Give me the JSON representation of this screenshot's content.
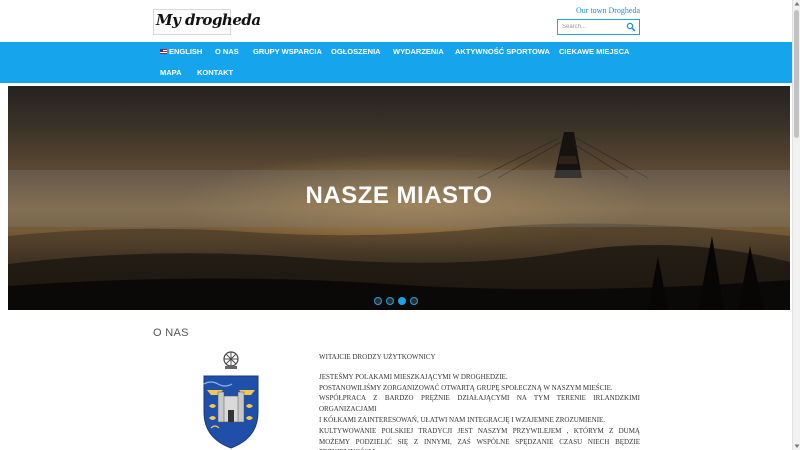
{
  "header": {
    "logo_text": "My drogheda",
    "top_link": "Our town Drogheda",
    "search_placeholder": "Search..."
  },
  "nav": {
    "items": [
      {
        "label": "English",
        "flag": true
      },
      {
        "label": "O nas"
      },
      {
        "label": "Grupy wsparcia"
      },
      {
        "label": "Ogłoszenia"
      },
      {
        "label": "Wydarzenia"
      },
      {
        "label": "Aktywność sportowa"
      },
      {
        "label": "Ciekawe miejsca"
      },
      {
        "label": "Mapa"
      },
      {
        "label": "Kontakt"
      }
    ]
  },
  "hero": {
    "title": "NASZE MIASTO",
    "slides_count": 4,
    "active_slide": 3
  },
  "content": {
    "section_title": "O NAS",
    "crest_icon": "drogheda-coat-of-arms",
    "greeting": "Witajcie drodzy użytkownicy",
    "paragraph_lines": [
      "Jesteśmy Polakami mieszkającymi w Droghedzie.",
      "Postanowiliśmy zorganizować otwartą grupę społeczną w naszym mieście."
    ],
    "cooperation_text": "Współpraca z bardzo prężnie działającymi na tym terenie irlandzkimi organizacjami",
    "clubs_text": "i kółkami zainteresowań, ułatwi nam integrację i wzajemne zrozumienie.",
    "tradition_text": "Kultywowanie polskiej tradycji jest naszym przywilejem , którym z dumą możemy podzielić się z innymi, zaś wspólne spędzanie czasu niech będzie przyjemnością."
  },
  "colors": {
    "accent": "#16a4ec",
    "link": "#1a8fd8",
    "body_text": "#333333"
  }
}
